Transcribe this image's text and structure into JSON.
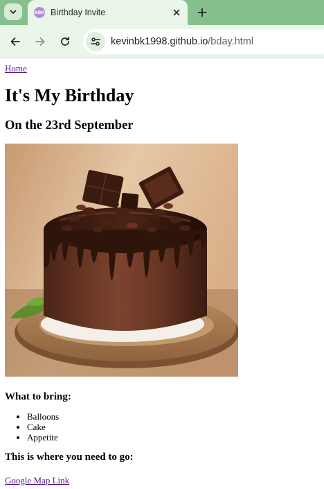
{
  "browser": {
    "tab_title": "Birthday Invite",
    "tab_favicon_text": "KBK",
    "url_host": "kevinbk1998.github.io",
    "url_path": "/bday.html",
    "tab_menu_icon": "chevron-down-icon",
    "new_tab_icon": "plus-icon",
    "close_icon": "close-icon",
    "back_icon": "arrow-left-icon",
    "forward_icon": "arrow-right-icon",
    "reload_icon": "reload-icon",
    "site_info_icon": "tune-icon",
    "chrome_color": "#86c08f",
    "toolbar_color": "#eaf6ea"
  },
  "page": {
    "home_link": "Home",
    "title": "It's My Birthday",
    "subtitle": "On the 23rd September",
    "bring_heading": "What to bring:",
    "bring_items": [
      "Balloons",
      "Cake",
      "Appetite"
    ],
    "location_heading": "This is where you need to go:",
    "map_link": "Google Map Link",
    "link_color": "#551a8b"
  }
}
